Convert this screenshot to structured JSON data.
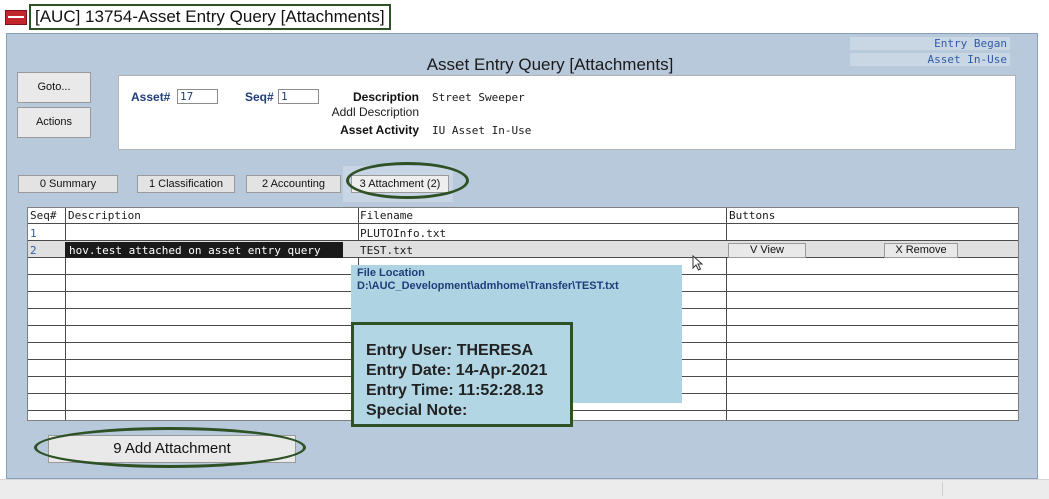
{
  "window": {
    "title": "[AUC] 13754-Asset Entry Query [Attachments]",
    "heading": "Asset Entry Query [Attachments]",
    "status_entry_began": "Entry Began",
    "status_asset_inuse": "Asset In-Use"
  },
  "actions": {
    "goto": "Goto...",
    "actions": "Actions"
  },
  "header": {
    "asset_label": "Asset#",
    "asset_value": "17",
    "seq_label": "Seq#",
    "seq_value": "1",
    "description_label": "Description",
    "description_value": "Street Sweeper",
    "addl_description_label": "Addl Description",
    "asset_activity_label": "Asset Activity",
    "asset_activity_value": "IU Asset In-Use"
  },
  "tabs": [
    {
      "label": "0 Summary"
    },
    {
      "label": "1 Classification"
    },
    {
      "label": "2 Accounting"
    },
    {
      "label": "3 Attachment (2)"
    }
  ],
  "grid": {
    "headers": [
      "Seq#",
      "Description",
      "Filename",
      "Buttons"
    ],
    "rows": [
      {
        "seq": "1",
        "description": "",
        "filename": "PLUTOInfo.txt"
      },
      {
        "seq": "2",
        "description": "hov.test attached on asset entry query",
        "filename": "TEST.txt",
        "view_label": "V View",
        "remove_label": "X Remove"
      }
    ]
  },
  "popup": {
    "file_location_label": "File Location",
    "file_location_value": "D:\\AUC_Development\\admhome\\Transfer\\TEST.txt",
    "entry_user": "Entry User: THERESA",
    "entry_date": "Entry Date: 14-Apr-2021",
    "entry_time": "Entry Time: 11:52:28.13",
    "special_note": "Special Note:"
  },
  "footer": {
    "add_attachment": "9 Add Attachment"
  },
  "colors": {
    "window_bg": "#b9c9dc",
    "popup_bg": "#aed4e3",
    "highlight_outline": "#2e5125",
    "label_blue": "#1f3d7a"
  }
}
